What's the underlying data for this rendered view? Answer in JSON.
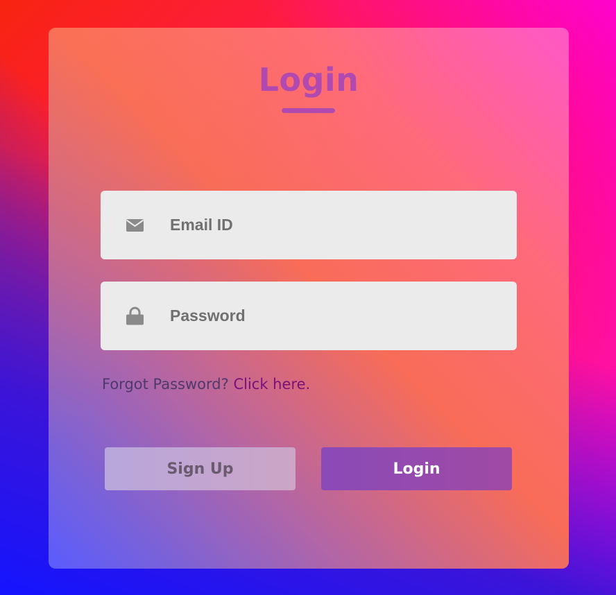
{
  "page": {
    "title": "Login"
  },
  "form": {
    "email": {
      "placeholder": "Email ID",
      "value": "",
      "icon": "envelope-icon"
    },
    "password": {
      "placeholder": "Password",
      "value": "",
      "icon": "lock-icon"
    },
    "forgot": {
      "text": "Forgot Password?",
      "link_text": "Click here."
    },
    "buttons": {
      "signup_label": "Sign Up",
      "login_label": "Login"
    }
  },
  "colors": {
    "title": "#b04ab0",
    "field_bg": "#ebebeb",
    "link": "#7a117a",
    "login_button": "#8a4ab8",
    "signup_button": "#b8a6dc"
  }
}
